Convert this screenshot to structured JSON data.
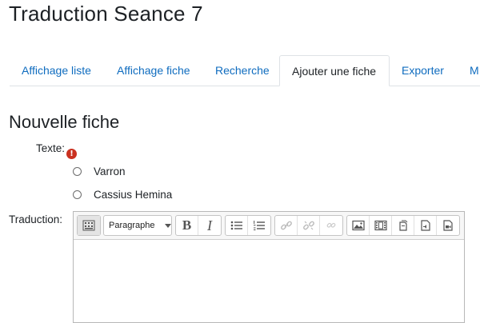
{
  "page": {
    "title": "Traduction Seance 7"
  },
  "tabs": [
    {
      "label": "Affichage liste"
    },
    {
      "label": "Affichage fiche"
    },
    {
      "label": "Recherche"
    },
    {
      "label": "Ajouter une fiche"
    },
    {
      "label": "Exporter"
    },
    {
      "label": "M"
    }
  ],
  "active_tab": "Ajouter une fiche",
  "form": {
    "title": "Nouvelle fiche",
    "texte_label": "Texte:",
    "required_icon": "!",
    "options": [
      {
        "label": "Varron",
        "checked": false
      },
      {
        "label": "Cassius Hemina",
        "checked": false
      }
    ],
    "traduction_label": "Traduction:"
  },
  "editor": {
    "format_select": "Paragraphe",
    "bold": "B",
    "italic": "I"
  },
  "colors": {
    "link": "#0f6cbf",
    "required": "#ca3120",
    "text": "#1d2125"
  }
}
